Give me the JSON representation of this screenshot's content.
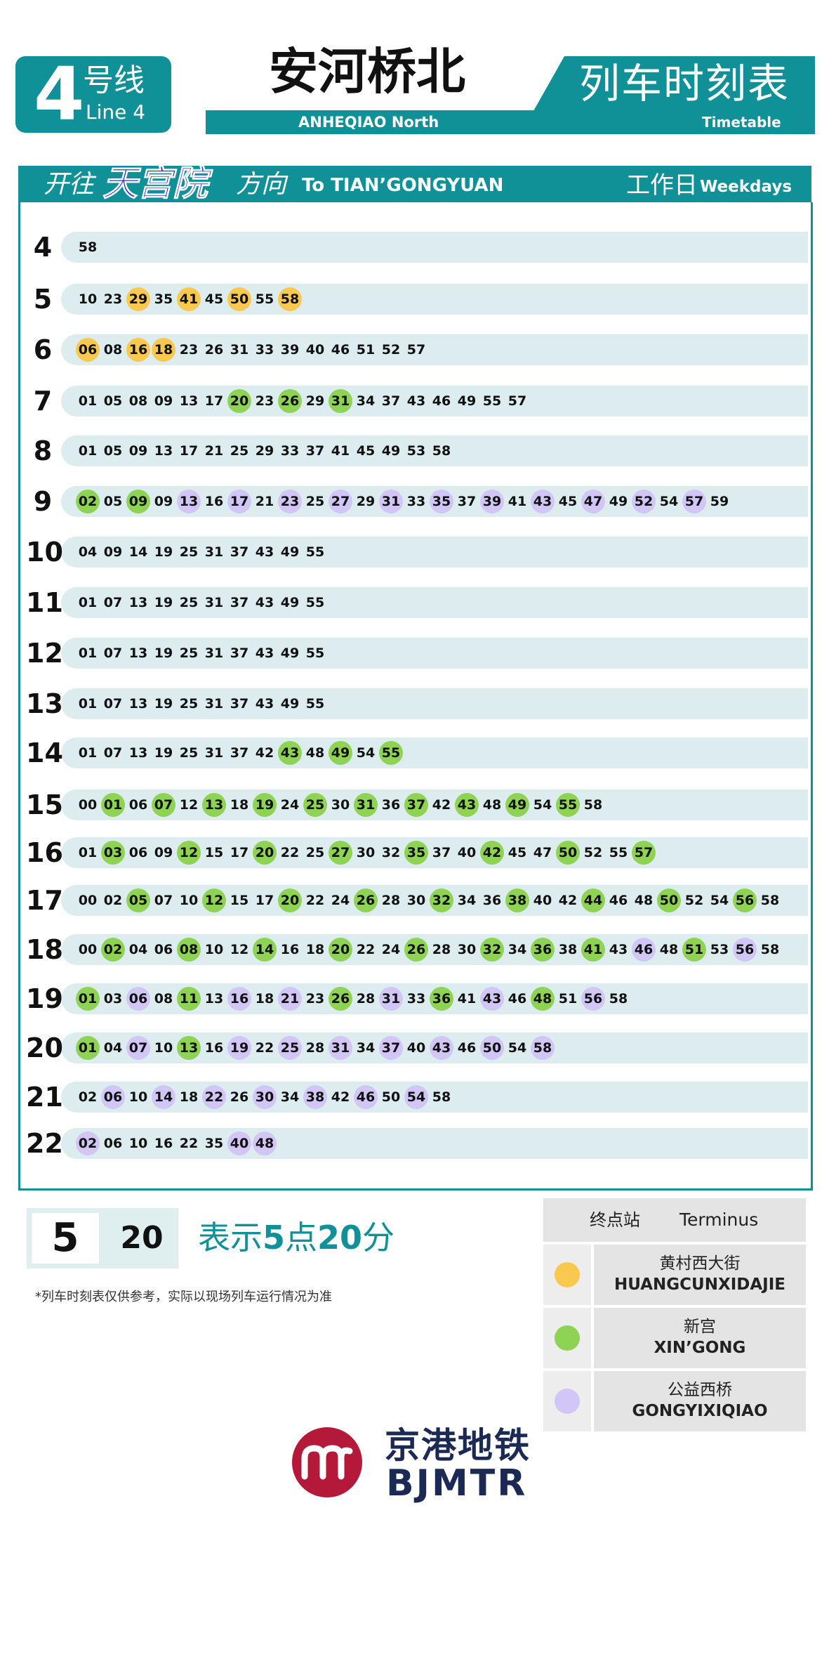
{
  "header": {
    "line_number": "4",
    "line_suffix_cn": "号线",
    "line_en": "Line 4",
    "station_cn": "安河桥北",
    "station_en": "ANHEQIAO North",
    "title_cn": "列车时刻表",
    "title_en": "Timetable"
  },
  "direction": {
    "to_cn_prefix": "开往",
    "terminal_cn": "天宫院",
    "to_cn_suffix": "方向",
    "to_en": "To TIAN’GONGYUAN",
    "day_cn": "工作日",
    "day_en": "Weekdays"
  },
  "colors": {
    "brand": "#0f9197",
    "huangcunxidajie": "#f9c94f",
    "xingong": "#8fd354",
    "gongyixiqiao": "#d1c6f5"
  },
  "timetable": [
    {
      "hour": "4",
      "mins": [
        [
          "58",
          ""
        ]
      ]
    },
    {
      "hour": "5",
      "mins": [
        [
          "10",
          ""
        ],
        [
          "23",
          ""
        ],
        [
          "29",
          "y"
        ],
        [
          "35",
          ""
        ],
        [
          "41",
          "y"
        ],
        [
          "45",
          ""
        ],
        [
          "50",
          "y"
        ],
        [
          "55",
          ""
        ],
        [
          "58",
          "y"
        ]
      ]
    },
    {
      "hour": "6",
      "mins": [
        [
          "06",
          "y"
        ],
        [
          "08",
          ""
        ],
        [
          "16",
          "y"
        ],
        [
          "18",
          "y"
        ],
        [
          "23",
          ""
        ],
        [
          "26",
          ""
        ],
        [
          "31",
          ""
        ],
        [
          "33",
          ""
        ],
        [
          "39",
          ""
        ],
        [
          "40",
          ""
        ],
        [
          "46",
          ""
        ],
        [
          "51",
          ""
        ],
        [
          "52",
          ""
        ],
        [
          "57",
          ""
        ]
      ]
    },
    {
      "hour": "7",
      "mins": [
        [
          "01",
          ""
        ],
        [
          "05",
          ""
        ],
        [
          "08",
          ""
        ],
        [
          "09",
          ""
        ],
        [
          "13",
          ""
        ],
        [
          "17",
          ""
        ],
        [
          "20",
          "g"
        ],
        [
          "23",
          ""
        ],
        [
          "26",
          "g"
        ],
        [
          "29",
          ""
        ],
        [
          "31",
          "g"
        ],
        [
          "34",
          ""
        ],
        [
          "37",
          ""
        ],
        [
          "43",
          ""
        ],
        [
          "46",
          ""
        ],
        [
          "49",
          ""
        ],
        [
          "55",
          ""
        ],
        [
          "57",
          ""
        ]
      ]
    },
    {
      "hour": "8",
      "mins": [
        [
          "01",
          ""
        ],
        [
          "05",
          ""
        ],
        [
          "09",
          ""
        ],
        [
          "13",
          ""
        ],
        [
          "17",
          ""
        ],
        [
          "21",
          ""
        ],
        [
          "25",
          ""
        ],
        [
          "29",
          ""
        ],
        [
          "33",
          ""
        ],
        [
          "37",
          ""
        ],
        [
          "41",
          ""
        ],
        [
          "45",
          ""
        ],
        [
          "49",
          ""
        ],
        [
          "53",
          ""
        ],
        [
          "58",
          ""
        ]
      ]
    },
    {
      "hour": "9",
      "mins": [
        [
          "02",
          "g"
        ],
        [
          "05",
          ""
        ],
        [
          "09",
          "g"
        ],
        [
          "09",
          ""
        ],
        [
          "13",
          "p"
        ],
        [
          "16",
          ""
        ],
        [
          "17",
          "p"
        ],
        [
          "21",
          ""
        ],
        [
          "23",
          "p"
        ],
        [
          "25",
          ""
        ],
        [
          "27",
          "p"
        ],
        [
          "29",
          ""
        ],
        [
          "31",
          "p"
        ],
        [
          "33",
          ""
        ],
        [
          "35",
          "p"
        ],
        [
          "37",
          ""
        ],
        [
          "39",
          "p"
        ],
        [
          "41",
          ""
        ],
        [
          "43",
          "p"
        ],
        [
          "45",
          ""
        ],
        [
          "47",
          "p"
        ],
        [
          "49",
          ""
        ],
        [
          "52",
          "p"
        ],
        [
          "54",
          ""
        ],
        [
          "57",
          "p"
        ],
        [
          "59",
          ""
        ]
      ]
    },
    {
      "hour": "10",
      "mins": [
        [
          "04",
          ""
        ],
        [
          "09",
          ""
        ],
        [
          "14",
          ""
        ],
        [
          "19",
          ""
        ],
        [
          "25",
          ""
        ],
        [
          "31",
          ""
        ],
        [
          "37",
          ""
        ],
        [
          "43",
          ""
        ],
        [
          "49",
          ""
        ],
        [
          "55",
          ""
        ]
      ]
    },
    {
      "hour": "11",
      "mins": [
        [
          "01",
          ""
        ],
        [
          "07",
          ""
        ],
        [
          "13",
          ""
        ],
        [
          "19",
          ""
        ],
        [
          "25",
          ""
        ],
        [
          "31",
          ""
        ],
        [
          "37",
          ""
        ],
        [
          "43",
          ""
        ],
        [
          "49",
          ""
        ],
        [
          "55",
          ""
        ]
      ]
    },
    {
      "hour": "12",
      "mins": [
        [
          "01",
          ""
        ],
        [
          "07",
          ""
        ],
        [
          "13",
          ""
        ],
        [
          "19",
          ""
        ],
        [
          "25",
          ""
        ],
        [
          "31",
          ""
        ],
        [
          "37",
          ""
        ],
        [
          "43",
          ""
        ],
        [
          "49",
          ""
        ],
        [
          "55",
          ""
        ]
      ]
    },
    {
      "hour": "13",
      "mins": [
        [
          "01",
          ""
        ],
        [
          "07",
          ""
        ],
        [
          "13",
          ""
        ],
        [
          "19",
          ""
        ],
        [
          "25",
          ""
        ],
        [
          "31",
          ""
        ],
        [
          "37",
          ""
        ],
        [
          "43",
          ""
        ],
        [
          "49",
          ""
        ],
        [
          "55",
          ""
        ]
      ]
    },
    {
      "hour": "14",
      "mins": [
        [
          "01",
          ""
        ],
        [
          "07",
          ""
        ],
        [
          "13",
          ""
        ],
        [
          "19",
          ""
        ],
        [
          "25",
          ""
        ],
        [
          "31",
          ""
        ],
        [
          "37",
          ""
        ],
        [
          "42",
          ""
        ],
        [
          "43",
          "g"
        ],
        [
          "48",
          ""
        ],
        [
          "49",
          "g"
        ],
        [
          "54",
          ""
        ],
        [
          "55",
          "g"
        ]
      ]
    },
    {
      "hour": "15",
      "mins": [
        [
          "00",
          ""
        ],
        [
          "01",
          "g"
        ],
        [
          "06",
          ""
        ],
        [
          "07",
          "g"
        ],
        [
          "12",
          ""
        ],
        [
          "13",
          "g"
        ],
        [
          "18",
          ""
        ],
        [
          "19",
          "g"
        ],
        [
          "24",
          ""
        ],
        [
          "25",
          "g"
        ],
        [
          "30",
          ""
        ],
        [
          "31",
          "g"
        ],
        [
          "36",
          ""
        ],
        [
          "37",
          "g"
        ],
        [
          "42",
          ""
        ],
        [
          "43",
          "g"
        ],
        [
          "48",
          ""
        ],
        [
          "49",
          "g"
        ],
        [
          "54",
          ""
        ],
        [
          "55",
          "g"
        ],
        [
          "58",
          ""
        ]
      ]
    },
    {
      "hour": "16",
      "mins": [
        [
          "01",
          ""
        ],
        [
          "03",
          "g"
        ],
        [
          "06",
          ""
        ],
        [
          "09",
          ""
        ],
        [
          "12",
          "g"
        ],
        [
          "15",
          ""
        ],
        [
          "17",
          ""
        ],
        [
          "20",
          "g"
        ],
        [
          "22",
          ""
        ],
        [
          "25",
          ""
        ],
        [
          "27",
          "g"
        ],
        [
          "30",
          ""
        ],
        [
          "32",
          ""
        ],
        [
          "35",
          "g"
        ],
        [
          "37",
          ""
        ],
        [
          "40",
          ""
        ],
        [
          "42",
          "g"
        ],
        [
          "45",
          ""
        ],
        [
          "47",
          ""
        ],
        [
          "50",
          "g"
        ],
        [
          "52",
          ""
        ],
        [
          "55",
          ""
        ],
        [
          "57",
          "g"
        ]
      ]
    },
    {
      "hour": "17",
      "mins": [
        [
          "00",
          ""
        ],
        [
          "02",
          ""
        ],
        [
          "05",
          "g"
        ],
        [
          "07",
          ""
        ],
        [
          "10",
          ""
        ],
        [
          "12",
          "g"
        ],
        [
          "15",
          ""
        ],
        [
          "17",
          ""
        ],
        [
          "20",
          "g"
        ],
        [
          "22",
          ""
        ],
        [
          "24",
          ""
        ],
        [
          "26",
          "g"
        ],
        [
          "28",
          ""
        ],
        [
          "30",
          ""
        ],
        [
          "32",
          "g"
        ],
        [
          "34",
          ""
        ],
        [
          "36",
          ""
        ],
        [
          "38",
          "g"
        ],
        [
          "40",
          ""
        ],
        [
          "42",
          ""
        ],
        [
          "44",
          "g"
        ],
        [
          "46",
          ""
        ],
        [
          "48",
          ""
        ],
        [
          "50",
          "g"
        ],
        [
          "52",
          ""
        ],
        [
          "54",
          ""
        ],
        [
          "56",
          "g"
        ],
        [
          "58",
          ""
        ]
      ]
    },
    {
      "hour": "18",
      "mins": [
        [
          "00",
          ""
        ],
        [
          "02",
          "g"
        ],
        [
          "04",
          ""
        ],
        [
          "06",
          ""
        ],
        [
          "08",
          "g"
        ],
        [
          "10",
          ""
        ],
        [
          "12",
          ""
        ],
        [
          "14",
          "g"
        ],
        [
          "16",
          ""
        ],
        [
          "18",
          ""
        ],
        [
          "20",
          "g"
        ],
        [
          "22",
          ""
        ],
        [
          "24",
          ""
        ],
        [
          "26",
          "g"
        ],
        [
          "28",
          ""
        ],
        [
          "30",
          ""
        ],
        [
          "32",
          "g"
        ],
        [
          "34",
          ""
        ],
        [
          "36",
          "g"
        ],
        [
          "38",
          ""
        ],
        [
          "41",
          "g"
        ],
        [
          "43",
          ""
        ],
        [
          "46",
          "p"
        ],
        [
          "48",
          ""
        ],
        [
          "51",
          "g"
        ],
        [
          "53",
          ""
        ],
        [
          "56",
          "p"
        ],
        [
          "58",
          ""
        ]
      ]
    },
    {
      "hour": "19",
      "mins": [
        [
          "01",
          "g"
        ],
        [
          "03",
          ""
        ],
        [
          "06",
          "p"
        ],
        [
          "08",
          ""
        ],
        [
          "11",
          "g"
        ],
        [
          "13",
          ""
        ],
        [
          "16",
          "p"
        ],
        [
          "18",
          ""
        ],
        [
          "21",
          "p"
        ],
        [
          "23",
          ""
        ],
        [
          "26",
          "g"
        ],
        [
          "28",
          ""
        ],
        [
          "31",
          "p"
        ],
        [
          "33",
          ""
        ],
        [
          "36",
          "g"
        ],
        [
          "41",
          ""
        ],
        [
          "43",
          "p"
        ],
        [
          "46",
          ""
        ],
        [
          "48",
          "g"
        ],
        [
          "51",
          ""
        ],
        [
          "56",
          "p"
        ],
        [
          "58",
          ""
        ]
      ]
    },
    {
      "hour": "20",
      "mins": [
        [
          "01",
          "g"
        ],
        [
          "04",
          ""
        ],
        [
          "07",
          "p"
        ],
        [
          "10",
          ""
        ],
        [
          "13",
          "g"
        ],
        [
          "16",
          ""
        ],
        [
          "19",
          "p"
        ],
        [
          "22",
          ""
        ],
        [
          "25",
          "p"
        ],
        [
          "28",
          ""
        ],
        [
          "31",
          "p"
        ],
        [
          "34",
          ""
        ],
        [
          "37",
          "p"
        ],
        [
          "40",
          ""
        ],
        [
          "43",
          "p"
        ],
        [
          "46",
          ""
        ],
        [
          "50",
          "p"
        ],
        [
          "54",
          ""
        ],
        [
          "58",
          "p"
        ]
      ]
    },
    {
      "hour": "21",
      "mins": [
        [
          "02",
          ""
        ],
        [
          "06",
          "p"
        ],
        [
          "10",
          ""
        ],
        [
          "14",
          "p"
        ],
        [
          "18",
          ""
        ],
        [
          "22",
          "p"
        ],
        [
          "26",
          ""
        ],
        [
          "30",
          "p"
        ],
        [
          "34",
          ""
        ],
        [
          "38",
          "p"
        ],
        [
          "42",
          ""
        ],
        [
          "46",
          "p"
        ],
        [
          "50",
          ""
        ],
        [
          "54",
          "p"
        ],
        [
          "58",
          ""
        ]
      ]
    },
    {
      "hour": "22",
      "mins": [
        [
          "02",
          "p"
        ],
        [
          "06",
          ""
        ],
        [
          "10",
          ""
        ],
        [
          "16",
          ""
        ],
        [
          "22",
          ""
        ],
        [
          "35",
          ""
        ],
        [
          "40",
          "p"
        ],
        [
          "48",
          "p"
        ]
      ]
    }
  ],
  "example": {
    "hour": "5",
    "minute": "20",
    "desc_pre": "表示",
    "desc_h": "5",
    "desc_mid": "点",
    "desc_m": "20",
    "desc_post": "分",
    "note": "*列车时刻表仅供参考，实际以现场列车运行情况为准"
  },
  "legend": {
    "header_cn": "终点站",
    "header_en": "Terminus",
    "items": [
      {
        "cn": "黄村西大街",
        "en": "HUANGCUNXIDAJIE"
      },
      {
        "cn": "新宫",
        "en": "XIN’GONG"
      },
      {
        "cn": "公益西桥",
        "en": "GONGYIXIQIAO"
      }
    ]
  },
  "logo": {
    "cn": "京港地铁",
    "en": "BJMTR"
  }
}
